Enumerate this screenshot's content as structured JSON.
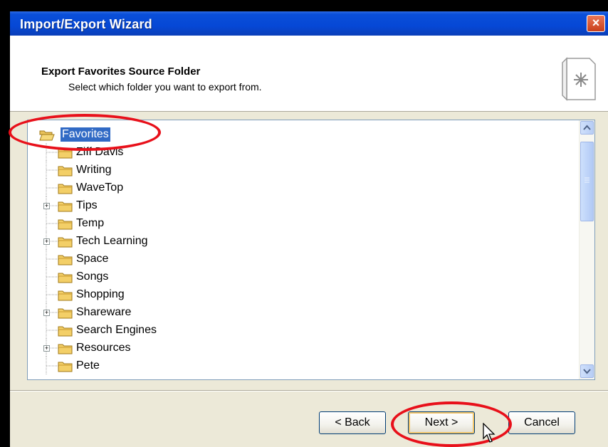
{
  "window": {
    "title": "Import/Export Wizard",
    "close_glyph": "×"
  },
  "header": {
    "title": "Export Favorites Source Folder",
    "subtitle": "Select which folder you want to export from.",
    "icon": "wizard-page-star-icon"
  },
  "tree": {
    "root": {
      "label": "Favorites",
      "selected": true,
      "icon": "open-folder-icon"
    },
    "items": [
      {
        "label": "Ziff Davis",
        "expandable": false
      },
      {
        "label": "Writing",
        "expandable": false
      },
      {
        "label": "WaveTop",
        "expandable": false
      },
      {
        "label": "Tips",
        "expandable": true
      },
      {
        "label": "Temp",
        "expandable": false
      },
      {
        "label": "Tech Learning",
        "expandable": true
      },
      {
        "label": "Space",
        "expandable": false
      },
      {
        "label": "Songs",
        "expandable": false
      },
      {
        "label": "Shopping",
        "expandable": false
      },
      {
        "label": "Shareware",
        "expandable": true
      },
      {
        "label": "Search Engines",
        "expandable": false
      },
      {
        "label": "Resources",
        "expandable": true
      },
      {
        "label": "Pete",
        "expandable": false
      }
    ],
    "expander_glyph": "+"
  },
  "buttons": {
    "back": "< Back",
    "next": "Next >",
    "cancel": "Cancel"
  },
  "colors": {
    "titlebar": "#0648d6",
    "selection": "#316ac5",
    "annotation": "#e8101a",
    "dialog_bg": "#ece9d8"
  }
}
